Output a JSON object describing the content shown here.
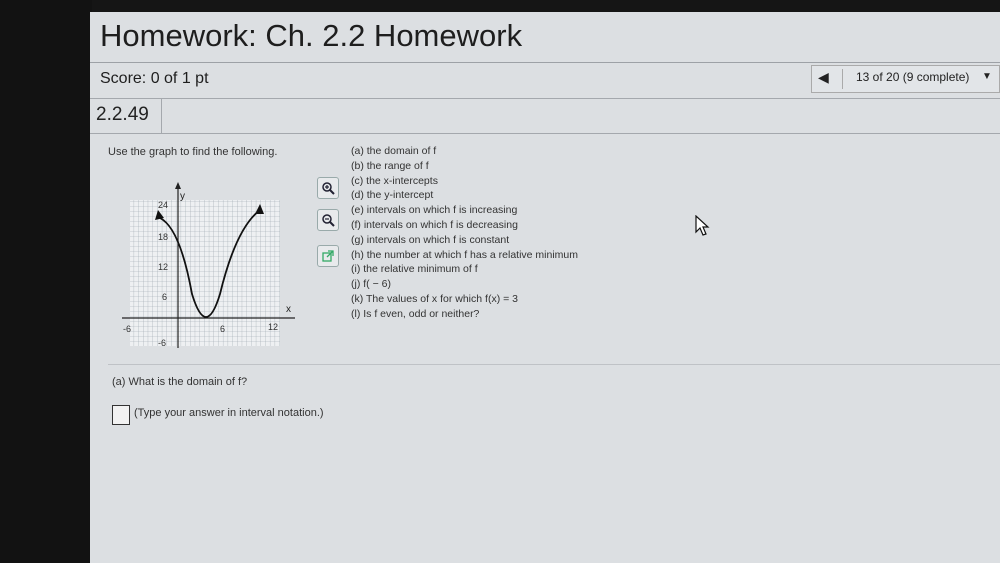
{
  "header": {
    "title": "Homework: Ch. 2.2 Homework",
    "score": "Score: 0 of 1 pt"
  },
  "pager": {
    "prev_label": "◀",
    "progress": "13 of 20 (9 complete)",
    "dropdown_label": "▼"
  },
  "question": {
    "number": "2.2.49",
    "instruction": "Use the graph to find the following.",
    "parts": [
      "(a) the domain of f",
      "(b) the range of f",
      "(c) the x-intercepts",
      "(d) the y-intercept",
      "(e) intervals on which f is increasing",
      "(f) intervals on which f is decreasing",
      "(g) intervals on which f is constant",
      "(h) the number at which f has a relative minimum",
      "(i) the relative minimum of f",
      "(j) f( − 6)",
      "(k) The values of x for which f(x) = 3",
      "(l) Is f even, odd or neither?"
    ],
    "subquestion": "(a) What is the domain of f?",
    "answer_hint": "(Type your answer in interval notation.)"
  },
  "graph": {
    "y_label": "y",
    "x_label": "x",
    "y_ticks": [
      "24",
      "18",
      "12",
      "6",
      "-6"
    ],
    "x_ticks": [
      "-6",
      "6",
      "12"
    ]
  },
  "icons": [
    "zoom-in-icon",
    "zoom-out-icon",
    "popout-icon"
  ]
}
